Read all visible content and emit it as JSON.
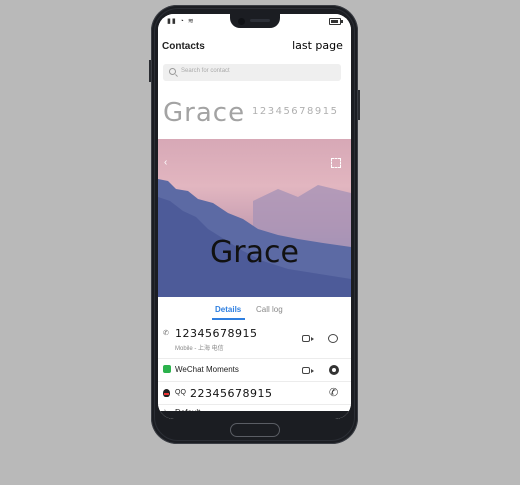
{
  "header": {
    "title": "Contacts",
    "last_page_button": "last page"
  },
  "search": {
    "placeholder": "Search for contact"
  },
  "contact": {
    "name": "Grace",
    "number": "12345678915",
    "hero_name": "Grace"
  },
  "tabs": [
    {
      "label": "Details",
      "active": true
    },
    {
      "label": "Call log",
      "active": false
    }
  ],
  "rows": {
    "phone": {
      "number": "12345678915",
      "sub": "Mobile - 上海 电信"
    },
    "wechat": {
      "label": "WeChat Moments"
    },
    "qq": {
      "number": "22345678915"
    },
    "default": {
      "label": "Default"
    }
  },
  "colors": {
    "accent": "#2f7fe0",
    "wechat": "#2bb24c"
  }
}
